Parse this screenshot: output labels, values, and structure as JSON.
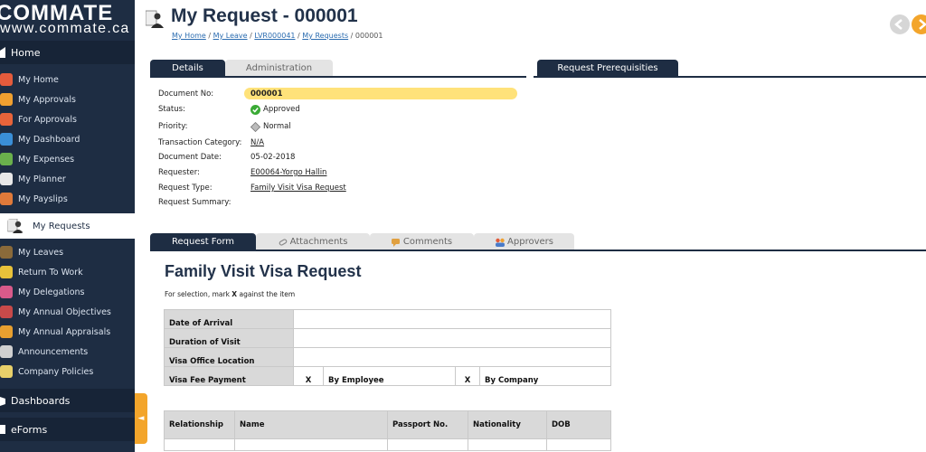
{
  "brand": {
    "name": "COMMATE",
    "url": "www.commate.ca"
  },
  "sidebar": {
    "home_label": "Home",
    "items": [
      {
        "label": "My Home",
        "color": "#e45b3c"
      },
      {
        "label": "My Approvals",
        "color": "#f0a030"
      },
      {
        "label": "For Approvals",
        "color": "#e8643a"
      },
      {
        "label": "My Dashboard",
        "color": "#3a8fd8"
      },
      {
        "label": "My Expenses",
        "color": "#6ab04c"
      },
      {
        "label": "My Planner",
        "color": "#e8e8e8"
      },
      {
        "label": "My Payslips",
        "color": "#e07a3a"
      },
      {
        "label": "My Requests",
        "color": "#2a2a2a"
      },
      {
        "label": "My Leaves",
        "color": "#8a6a3a"
      },
      {
        "label": "Return To Work",
        "color": "#e8c23a"
      },
      {
        "label": "My Delegations",
        "color": "#d85a8a"
      },
      {
        "label": "My Annual Objectives",
        "color": "#c84a4a"
      },
      {
        "label": "My Annual Appraisals",
        "color": "#e8a030"
      },
      {
        "label": "Announcements",
        "color": "#d0d0d0"
      },
      {
        "label": "Company Policies",
        "color": "#e8d06a"
      }
    ],
    "dashboards_label": "Dashboards",
    "eforms_label": "eForms",
    "collapse_glyph": "◄"
  },
  "page": {
    "title": "My Request - 000001",
    "breadcrumb": [
      {
        "label": "My Home"
      },
      {
        "label": "My Leave"
      },
      {
        "label": "LVR000041"
      },
      {
        "label": "My Requests"
      }
    ],
    "breadcrumb_current": "000001",
    "breadcrumb_sep": " / "
  },
  "top_tabs": {
    "details": "Details",
    "administration": "Administration",
    "prerequisites": "Request Prerequisities"
  },
  "fields": {
    "document_no_label": "Document No:",
    "document_no": "000001",
    "status_label": "Status:",
    "status": "Approved",
    "priority_label": "Priority:",
    "priority": "Normal",
    "transaction_category_label": "Transaction Category:",
    "transaction_category": "N/A",
    "document_date_label": "Document Date:",
    "document_date": "05-02-2018",
    "requester_label": "Requester:",
    "requester": "E00064-Yorgo Hallin",
    "request_type_label": "Request Type:",
    "request_type": "Family Visit Visa Request",
    "request_summary_label": "Request Summary:"
  },
  "form_tabs": {
    "request_form": "Request Form",
    "attachments": "Attachments",
    "comments": "Comments",
    "approvers": "Approvers"
  },
  "form": {
    "title": "Family Visit Visa Request",
    "note_prefix": "For selection, mark ",
    "note_mark": "X",
    "note_suffix": " against the item",
    "rows": [
      "Date of Arrival",
      "Duration of Visit",
      "Visa Office Location",
      "Visa Fee Payment"
    ],
    "fee_mark_1": "X",
    "fee_option_1": "By Employee",
    "fee_mark_2": "X",
    "fee_option_2": "By Company",
    "family_headers": [
      "Relationship",
      "Name",
      "Passport No.",
      "Nationality",
      "DOB"
    ]
  },
  "colors": {
    "sidebar_bg": "#1e2d43",
    "accent": "#f3a52b",
    "docno_highlight": "#ffe27a",
    "status_ok": "#3aaa35"
  }
}
